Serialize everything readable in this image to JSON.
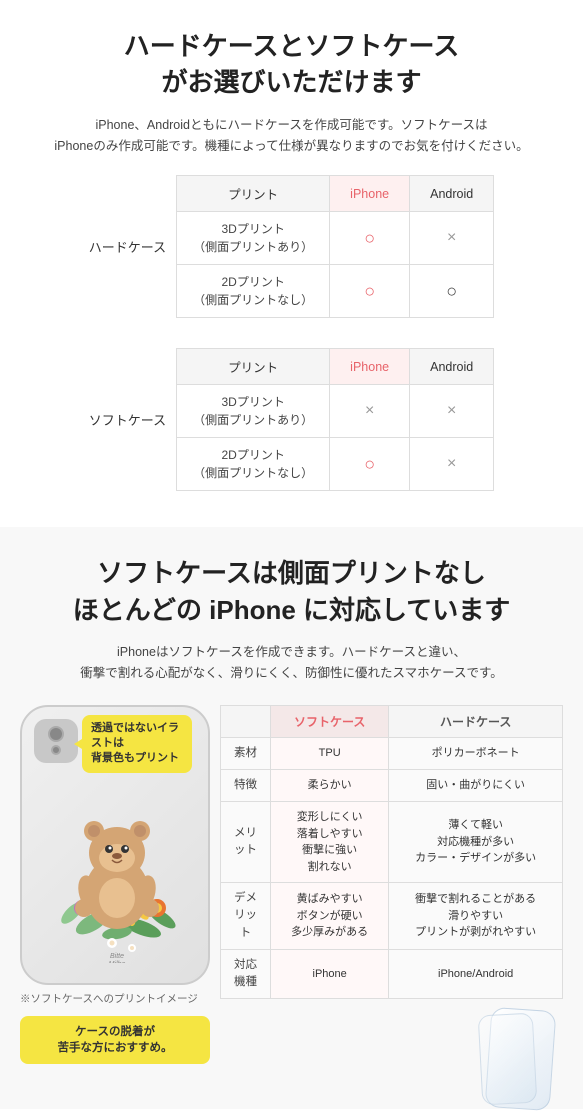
{
  "section1": {
    "main_title": "ハードケースとソフトケース\nがお選びいただけます",
    "subtitle": "iPhone、Androidともにハードケースを作成可能です。ソフトケースは\niPhoneのみ作成可能です。機種によって仕様が異なりますのでお気を付けください。",
    "table1": {
      "label": "ハードケース",
      "headers": [
        "プリント",
        "iPhone",
        "Android"
      ],
      "rows": [
        {
          "print": "3Dプリント\n（側面プリントあり）",
          "iphone": "○",
          "android": "×"
        },
        {
          "print": "2Dプリント\n（側面プリントなし）",
          "iphone": "○",
          "android": "○"
        }
      ]
    },
    "table2": {
      "label": "ソフトケース",
      "headers": [
        "プリント",
        "iPhone",
        "Android"
      ],
      "rows": [
        {
          "print": "3Dプリント\n（側面プリントあり）",
          "iphone": "×",
          "android": "×"
        },
        {
          "print": "2Dプリント\n（側面プリントなし）",
          "iphone": "○",
          "android": "×"
        }
      ]
    }
  },
  "section2": {
    "main_title": "ソフトケースは側面プリントなし\nほとんどの iPhone に対応しています",
    "subtitle": "iPhoneはソフトケースを作成できます。ハードケースと違い、\n衝撃で割れる心配がなく、滑りにくく、防御性に優れたスマホケースです。",
    "phone_tooltip": "透過ではないイラストは\n背景色もプリント",
    "phone_brand": "Bitte\nMilbe",
    "bottom_tooltip": "ケースの脱着が\n苦手な方におすすめ。",
    "phone_note": "※ソフトケースへのプリントイメージ",
    "feature_table": {
      "headers": [
        "",
        "ソフトケース",
        "ハードケース"
      ],
      "rows": [
        {
          "label": "素材",
          "soft": "TPU",
          "hard": "ポリカーボネート"
        },
        {
          "label": "特徴",
          "soft": "柔らかい",
          "hard": "固い・曲がりにくい"
        },
        {
          "label": "メリット",
          "soft": "変形しにくい\n落着しやすい\n衝撃に強い\n割れない",
          "hard": "薄くて軽い\n対応機種が多い\nカラー・デザインが多い"
        },
        {
          "label": "デメリット",
          "soft": "黄ばみやすい\nボタンが硬い\n多少厚みがある",
          "hard": "衝撃で割れることがある\n滑りやすい\nプリントが剥がれやすい"
        },
        {
          "label": "対応機種",
          "soft": "iPhone",
          "hard": "iPhone/Android"
        }
      ]
    }
  }
}
